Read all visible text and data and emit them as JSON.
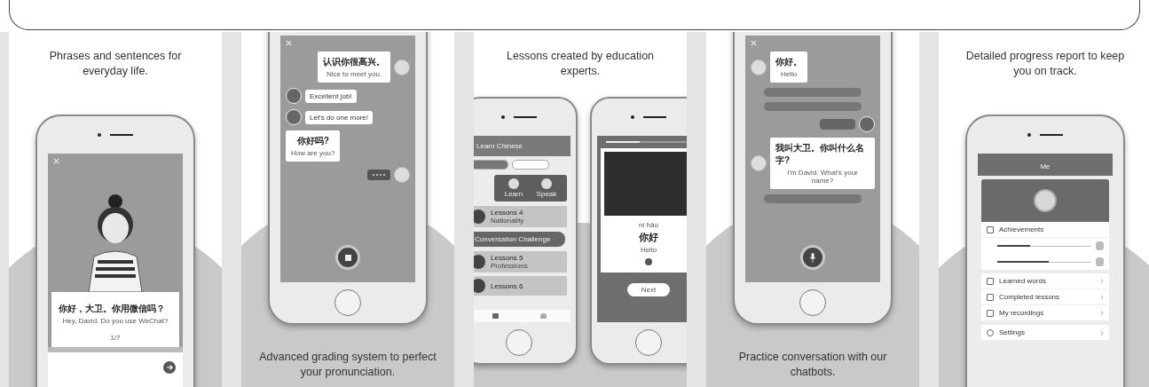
{
  "panels": [
    {
      "caption": "Phrases and sentences for everyday life.",
      "caption_below": false,
      "screen": {
        "kind": "intro",
        "hanzi": "你好，大卫。你用微信吗？",
        "english": "Hey, David. Do you use WeChat?",
        "page": "1/7"
      }
    },
    {
      "caption": "Advanced grading system to perfect your pronunciation.",
      "caption_below": true,
      "screen": {
        "kind": "grading",
        "messages": [
          {
            "kind": "user_card",
            "hanzi": "认识你很高兴。",
            "english": "Nice to meet you."
          },
          {
            "kind": "bot",
            "text": "Excellent job!"
          },
          {
            "kind": "bot",
            "text": "Let's do one more!"
          },
          {
            "kind": "bot_card",
            "hanzi": "你好吗?",
            "english": "How are you?"
          },
          {
            "kind": "typing"
          }
        ]
      }
    },
    {
      "caption": "Lessons created by education experts.",
      "caption_below": false,
      "screen": {
        "kind": "lessons",
        "header": "Learn Chinese",
        "actions": [
          "Learn",
          "Speak"
        ],
        "lessons": [
          {
            "kind": "lesson",
            "title": "Lessons 4",
            "subtitle": "Nationality"
          },
          {
            "kind": "banner",
            "title": "Conversation Challenge"
          },
          {
            "kind": "lesson",
            "title": "Lessons 5",
            "subtitle": "Professions"
          },
          {
            "kind": "lesson",
            "title": "Lessons 6"
          }
        ],
        "progress": {
          "level": 0.4
        },
        "pinyin": "nǐ hǎo",
        "hanzi": "你好",
        "meaning": "Hello",
        "button": "Next"
      }
    },
    {
      "caption": "Practice conversation with our chatbots.",
      "caption_below": true,
      "screen": {
        "kind": "chat",
        "messages": [
          {
            "kind": "card",
            "hanzi": "你好。",
            "english": "Hello"
          },
          {
            "kind": "pill"
          },
          {
            "kind": "pill"
          },
          {
            "kind": "audio"
          },
          {
            "kind": "card",
            "hanzi": "我叫大卫。你叫什么名字?",
            "english": "I'm David. What's your name?"
          },
          {
            "kind": "pill"
          }
        ]
      }
    },
    {
      "caption": "Detailed progress report to keep you on track.",
      "caption_below": false,
      "screen": {
        "kind": "profile",
        "title": "Me",
        "section": "Achievements",
        "bars": [
          {
            "level": 0.35
          },
          {
            "level": 0.55
          }
        ],
        "menu": [
          "Learned words",
          "Completed lessons",
          "My recordings"
        ],
        "settings": "Settings"
      }
    }
  ]
}
